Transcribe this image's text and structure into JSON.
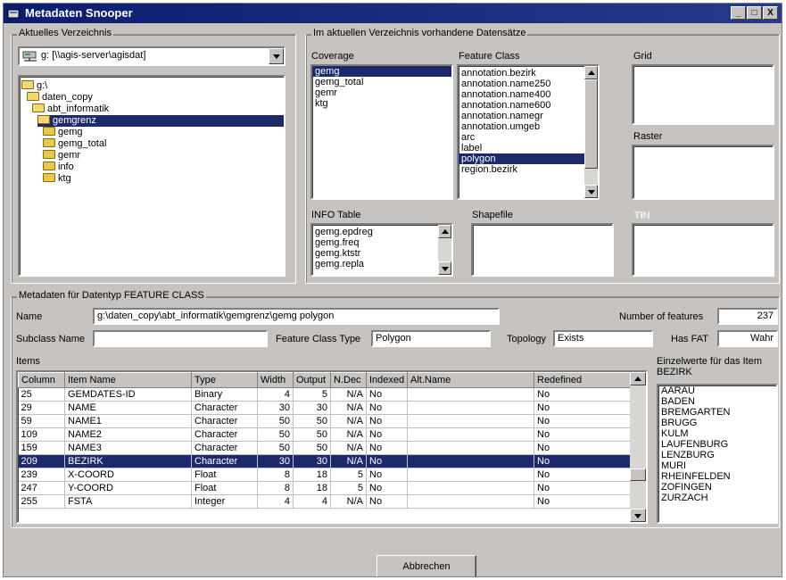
{
  "window": {
    "title": "Metadaten Snooper",
    "controls": [
      "_",
      "□",
      "X"
    ]
  },
  "directory": {
    "legend": "Aktuelles Verzeichnis",
    "drive": "g: [\\\\agis-server\\agisdat]",
    "tree": [
      {
        "label": "g:\\",
        "level": 0,
        "icon": "drive-folder-open-icon",
        "selected": false
      },
      {
        "label": "daten_copy",
        "level": 1,
        "icon": "folder-open-icon",
        "selected": false
      },
      {
        "label": "abt_informatik",
        "level": 2,
        "icon": "folder-open-icon",
        "selected": false
      },
      {
        "label": "gemgrenz",
        "level": 3,
        "icon": "folder-open-icon",
        "selected": true
      },
      {
        "label": "gemg",
        "level": 4,
        "icon": "folder-icon",
        "selected": false
      },
      {
        "label": "gemg_total",
        "level": 4,
        "icon": "folder-icon",
        "selected": false
      },
      {
        "label": "gemr",
        "level": 4,
        "icon": "folder-icon",
        "selected": false
      },
      {
        "label": "info",
        "level": 4,
        "icon": "folder-icon",
        "selected": false
      },
      {
        "label": "ktg",
        "level": 4,
        "icon": "folder-icon",
        "selected": false
      }
    ]
  },
  "datasets": {
    "legend": "Im aktuellen Verzeichnis vorhandene Datensätze",
    "coverage": {
      "label": "Coverage",
      "items": [
        "gemg",
        "gemg_total",
        "gemr",
        "ktg"
      ],
      "selected_index": 0
    },
    "feature_class": {
      "label": "Feature Class",
      "items": [
        "annotation.bezirk",
        "annotation.name250",
        "annotation.name400",
        "annotation.name600",
        "annotation.namegr",
        "annotation.umgeb",
        "arc",
        "label",
        "polygon",
        "region.bezirk"
      ],
      "selected_index": 8
    },
    "grid": {
      "label": "Grid"
    },
    "raster": {
      "label": "Raster"
    },
    "info_table": {
      "label": "INFO Table",
      "items": [
        "gemg.epdreg",
        "gemg.freq",
        "gemg.ktstr",
        "gemg.repla"
      ]
    },
    "shapefile": {
      "label": "Shapefile"
    },
    "tin": {
      "label": "TIN"
    }
  },
  "metadata": {
    "legend": "Metadaten für Datentyp FEATURE CLASS",
    "name_label": "Name",
    "name_value": "g:\\daten_copy\\abt_informatik\\gemgrenz\\gemg polygon",
    "num_features_label": "Number of features",
    "num_features_value": "237",
    "subclass_label": "Subclass Name",
    "subclass_value": "",
    "fc_type_label": "Feature Class Type",
    "fc_type_value": "Polygon",
    "topology_label": "Topology",
    "topology_value": "Exists",
    "hasfat_label": "Has FAT",
    "hasfat_value": "Wahr",
    "items_label": "Items",
    "columns": [
      "Column",
      "Item Name",
      "Type",
      "Width",
      "Output",
      "N.Dec",
      "Indexed",
      "Alt.Name",
      "Redefined"
    ],
    "rows": [
      [
        "25",
        "GEMDATES-ID",
        "Binary",
        "4",
        "5",
        "N/A",
        "No",
        "",
        "No"
      ],
      [
        "29",
        "NAME",
        "Character",
        "30",
        "30",
        "N/A",
        "No",
        "",
        "No"
      ],
      [
        "59",
        "NAME1",
        "Character",
        "50",
        "50",
        "N/A",
        "No",
        "",
        "No"
      ],
      [
        "109",
        "NAME2",
        "Character",
        "50",
        "50",
        "N/A",
        "No",
        "",
        "No"
      ],
      [
        "159",
        "NAME3",
        "Character",
        "50",
        "50",
        "N/A",
        "No",
        "",
        "No"
      ],
      [
        "209",
        "BEZIRK",
        "Character",
        "30",
        "30",
        "N/A",
        "No",
        "",
        "No"
      ],
      [
        "239",
        "X-COORD",
        "Float",
        "8",
        "18",
        "5",
        "No",
        "",
        "No"
      ],
      [
        "247",
        "Y-COORD",
        "Float",
        "8",
        "18",
        "5",
        "No",
        "",
        "No"
      ],
      [
        "255",
        "FSTA",
        "Integer",
        "4",
        "4",
        "N/A",
        "No",
        "",
        "No"
      ]
    ],
    "selected_row": 5,
    "values_label_line1": "Einzelwerte für das Item",
    "values_label_line2": "BEZIRK",
    "values": [
      "AARAU",
      "BADEN",
      "BREMGARTEN",
      "BRUGG",
      "KULM",
      "LAUFENBURG",
      "LENZBURG",
      "MURI",
      "RHEINFELDEN",
      "ZOFINGEN",
      "ZURZACH"
    ]
  },
  "cancel_button": "Abbrechen"
}
